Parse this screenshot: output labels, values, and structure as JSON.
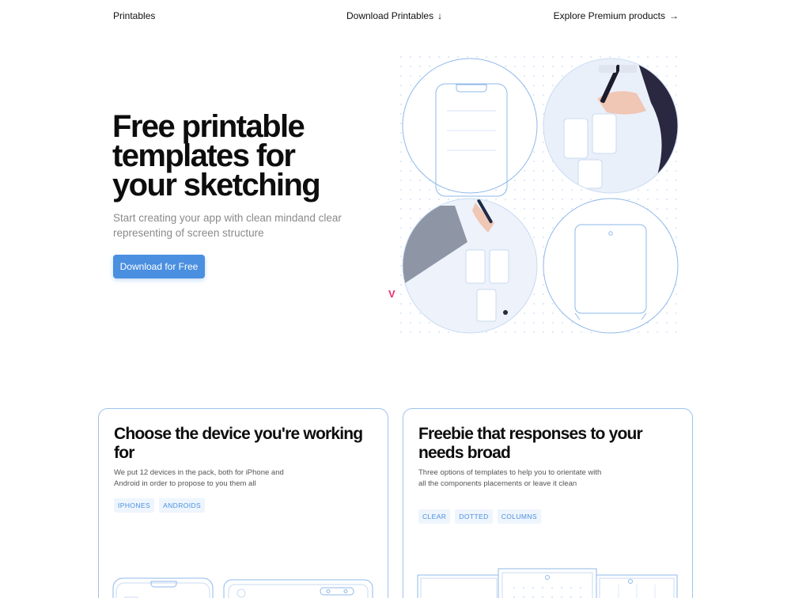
{
  "nav": {
    "left": "Printables",
    "center": "Download Printables",
    "center_icon": "↓",
    "right": "Explore Premium products",
    "right_icon": "→"
  },
  "hero": {
    "title": "Free printable templates for your sketching",
    "subtitle": "Start creating your app with clean mindand clear representing of screen structure",
    "cta": "Download for Free",
    "logo": "V"
  },
  "cards": [
    {
      "title": "Choose the device you're working for",
      "desc": "We put 12 devices in the pack, both for iPhone and Android in order to propose to you them all",
      "tags": [
        "IPHONES",
        "ANDROIDS"
      ]
    },
    {
      "title": "Freebie that responses to your needs broad",
      "desc": "Three options of templates to help you to orientate with all the components placements or leave it clean",
      "tags": [
        "CLEAR",
        "DOTTED",
        "COLUMNS"
      ]
    }
  ],
  "colors": {
    "accent": "#4a8fe0",
    "line": "#9ec3ee",
    "logo": "#e8306b"
  }
}
